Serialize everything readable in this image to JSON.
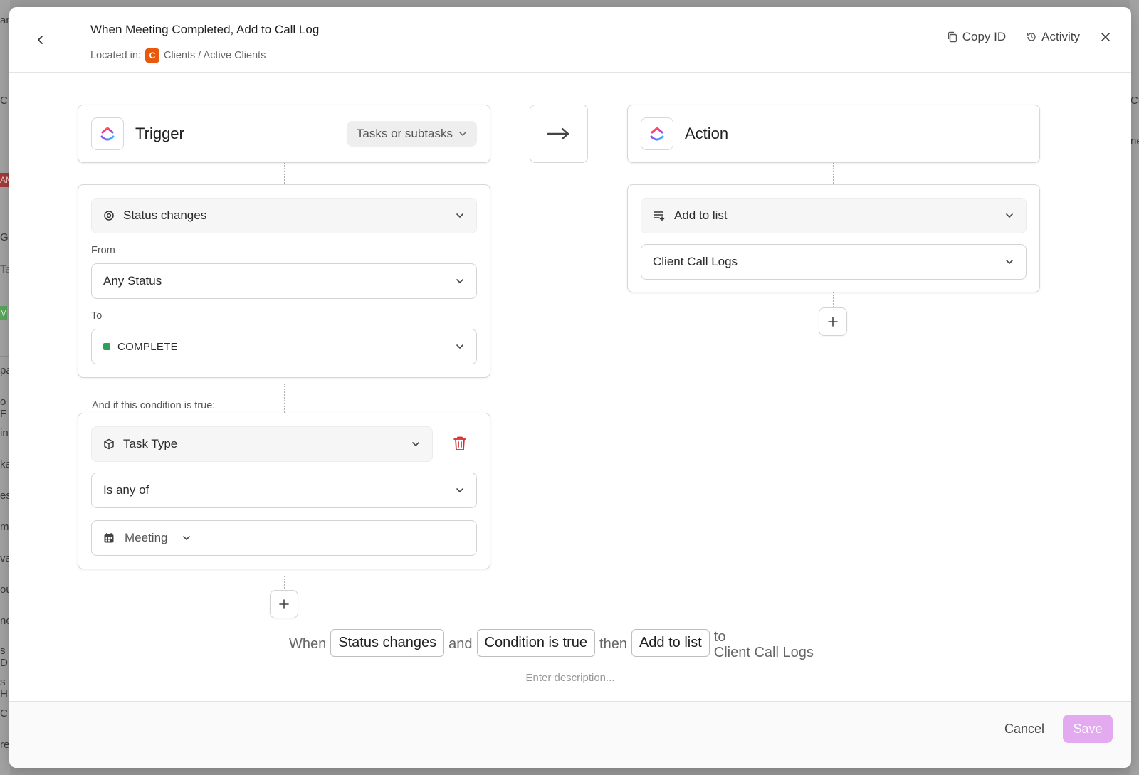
{
  "background": {
    "left_fragments": [
      "ar",
      "C",
      "AM",
      "Gr",
      "Ta",
      "M",
      "pa",
      "o F",
      "in",
      "ka",
      "es",
      "me",
      "va",
      "ou",
      "nc",
      "s D",
      "s H",
      "C",
      "re"
    ],
    "right_fragments": [
      "Cu",
      "ne"
    ]
  },
  "header": {
    "title": "When Meeting Completed, Add to Call Log",
    "location_label": "Located in:",
    "space_initial": "C",
    "location_path": "Clients / Active Clients",
    "copy_id_label": "Copy ID",
    "activity_label": "Activity"
  },
  "trigger": {
    "title": "Trigger",
    "scope": "Tasks or subtasks",
    "event": "Status changes",
    "from_label": "From",
    "from_value": "Any Status",
    "to_label": "To",
    "to_value": "COMPLETE",
    "to_color": "#2e9e5b"
  },
  "condition": {
    "label": "And if this condition is true:",
    "field": "Task Type",
    "operator": "Is any of",
    "value": "Meeting"
  },
  "action": {
    "title": "Action",
    "type": "Add to list",
    "target": "Client Call Logs"
  },
  "summary": {
    "when": "When",
    "trigger_chip": "Status changes",
    "and": "and",
    "condition_chip": "Condition is true",
    "then": "then",
    "action_chip": "Add to list",
    "to": "to",
    "target": "Client Call Logs",
    "description_placeholder": "Enter description..."
  },
  "footer": {
    "cancel_label": "Cancel",
    "save_label": "Save"
  },
  "colors": {
    "accent_save": "#e3aaf0",
    "space_badge": "#e8590c",
    "delete_red": "#d62b2b"
  }
}
